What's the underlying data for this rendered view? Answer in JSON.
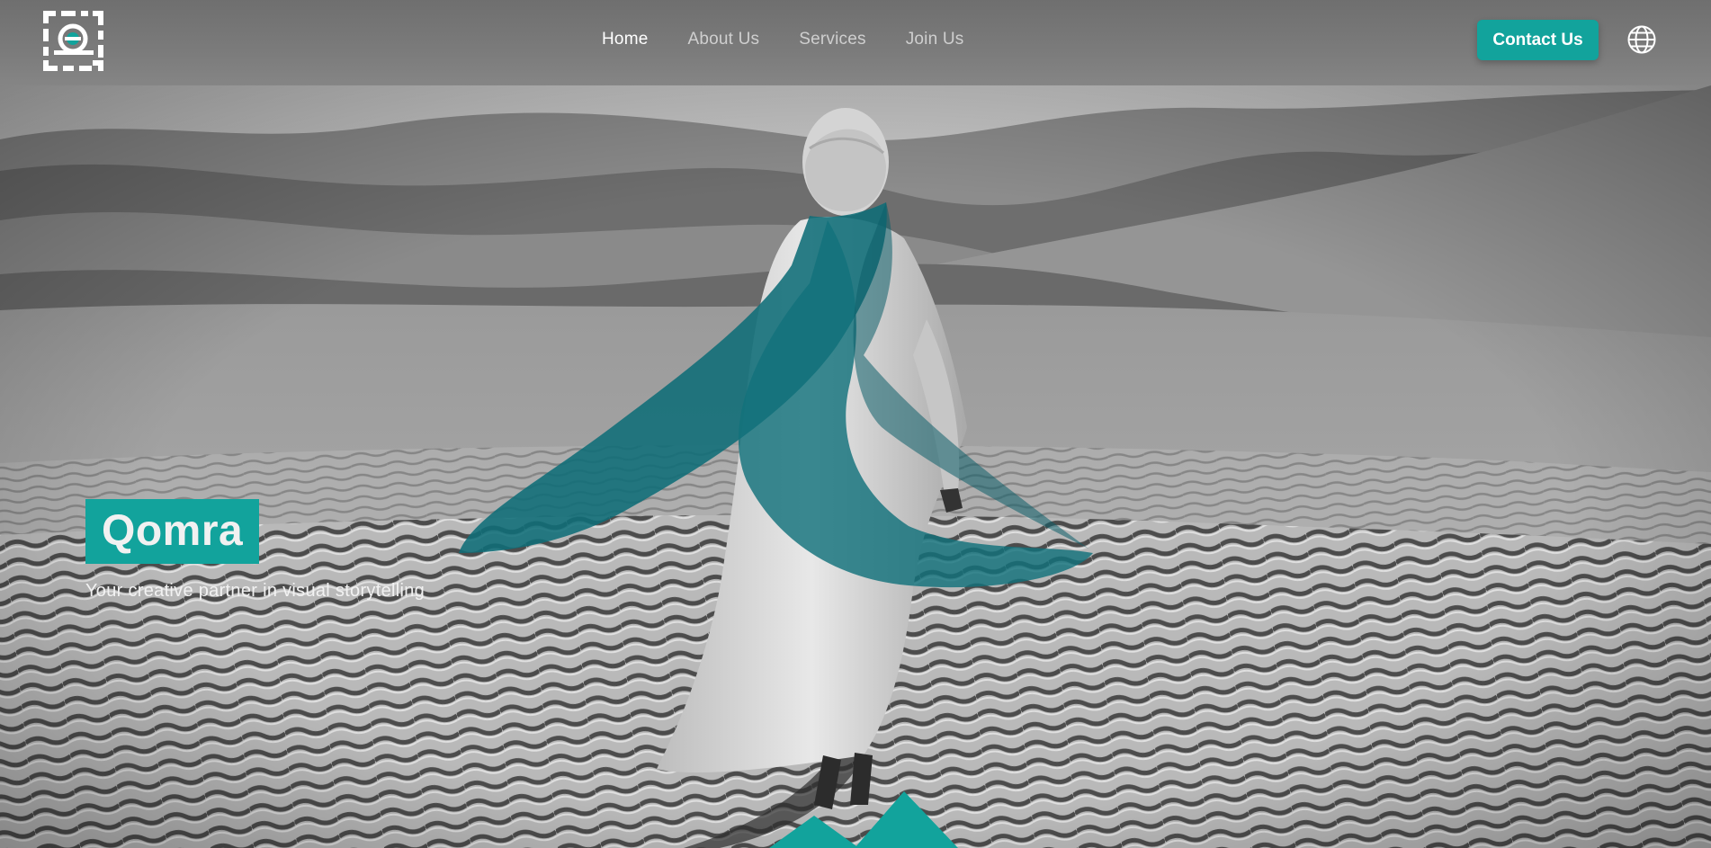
{
  "header": {
    "logo_icon": "qomra-logo-icon",
    "nav": [
      {
        "label": "Home",
        "active": true
      },
      {
        "label": "About Us",
        "active": false
      },
      {
        "label": "Services",
        "active": false
      },
      {
        "label": "Join Us",
        "active": false
      }
    ],
    "contact_label": "Contact Us",
    "language_icon": "globe-icon"
  },
  "hero": {
    "title": "Qomra",
    "subtitle": "Your creative partner in visual storytelling"
  },
  "colors": {
    "accent": "#12a39c",
    "scarf": "#12707a",
    "header_bg": "#777777"
  }
}
